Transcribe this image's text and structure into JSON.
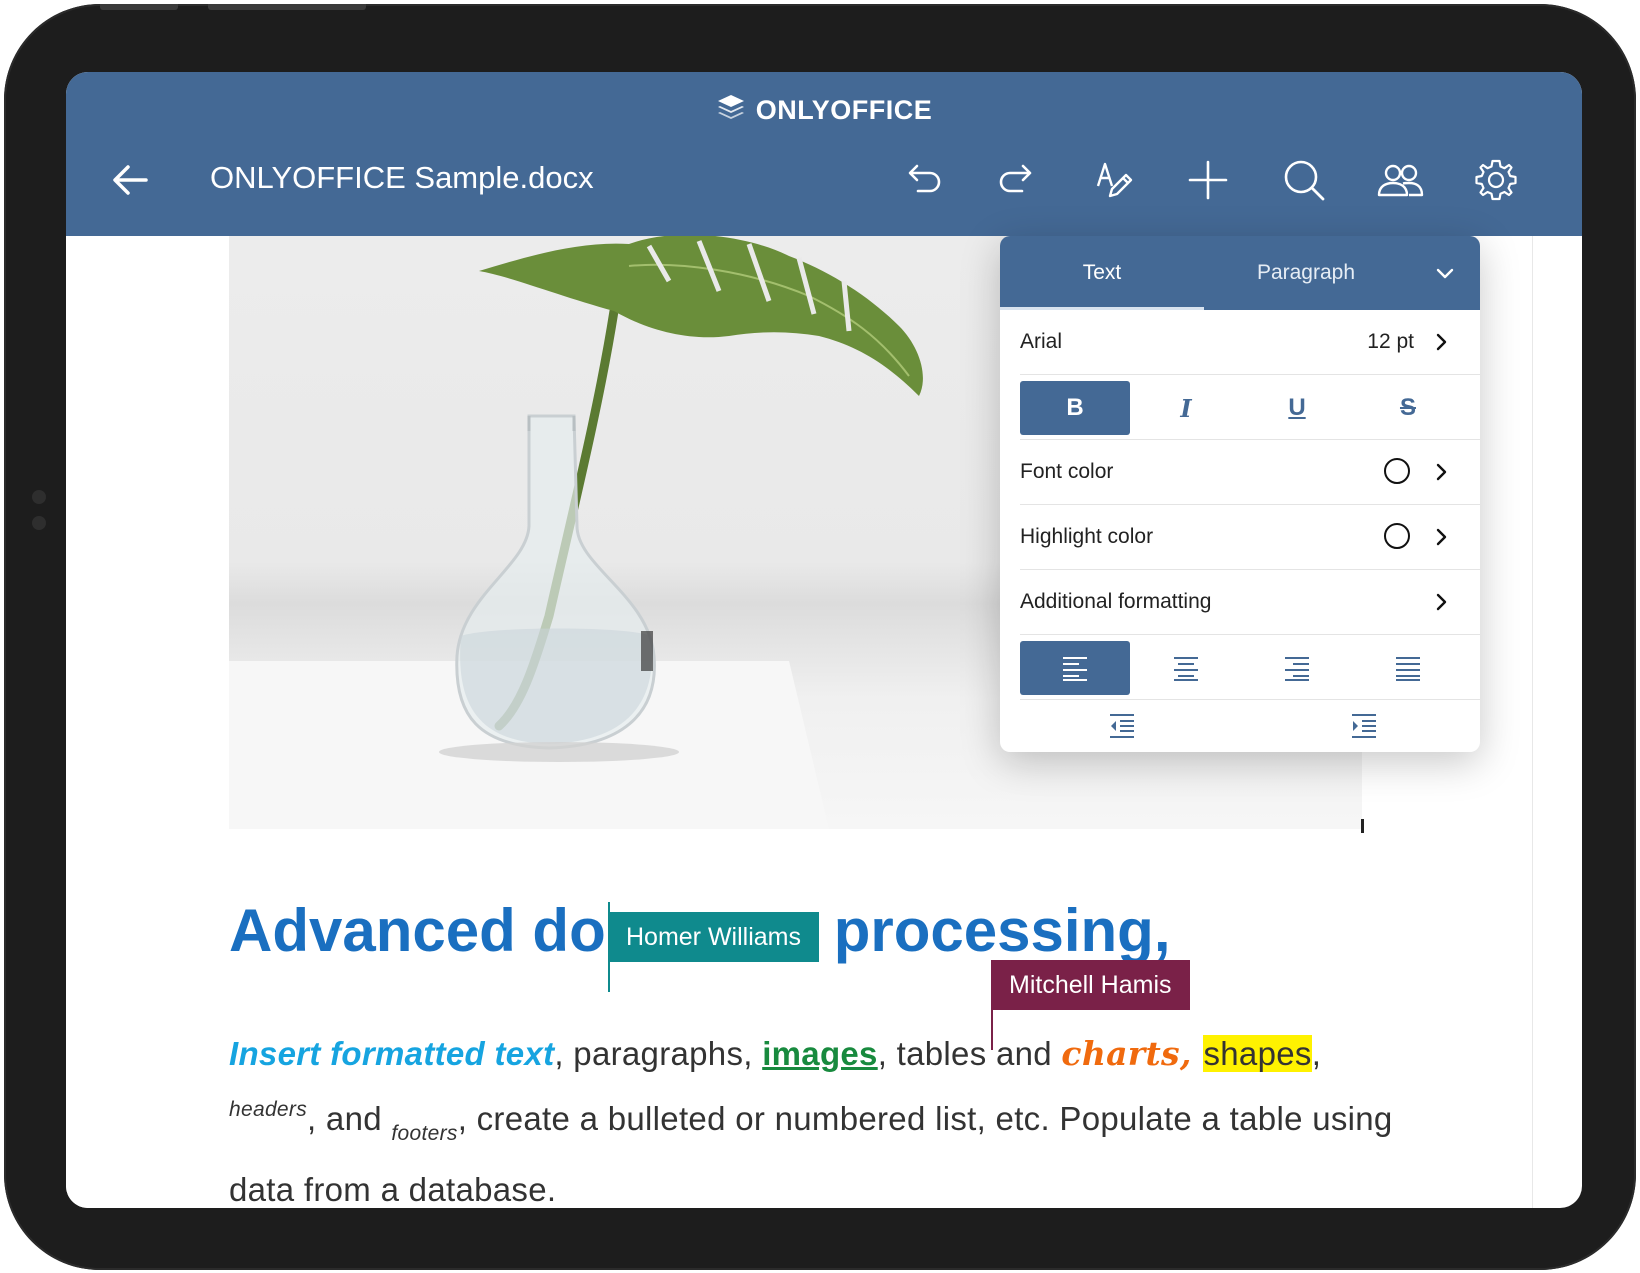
{
  "app": {
    "brand": "ONLYOFFICE",
    "document_title": "ONLYOFFICE Sample.docx"
  },
  "toolbar": {
    "icons": [
      "back-arrow-icon",
      "undo-icon",
      "redo-icon",
      "edit-text-icon",
      "add-icon",
      "search-icon",
      "users-icon",
      "settings-icon"
    ]
  },
  "document": {
    "heading_before": "Advanced do",
    "heading_after": "processing,",
    "para": {
      "p1": "Insert formatted text",
      "p2": ",  paragraphs, ",
      "p3": "images",
      "p4": ", tables and ",
      "p5": "charts",
      "p6": ", ",
      "p7": "shapes",
      "p8": ",",
      "p9": "headers",
      "p10": ", and ",
      "p11": "footers",
      "p12": ", create a bulleted or numbered list, etc. Populate a table using data from a database."
    },
    "collaborators": [
      {
        "name": "Homer Williams",
        "color": "#0f8a8d"
      },
      {
        "name": "Mitchell Hamis",
        "color": "#7a2148"
      }
    ]
  },
  "panel": {
    "tabs": {
      "text": "Text",
      "paragraph": "Paragraph"
    },
    "font_name": "Arial",
    "font_size": "12 pt",
    "style_buttons": {
      "bold": "B",
      "italic": "I",
      "underline": "U",
      "strike": "S"
    },
    "font_color_label": "Font color",
    "highlight_color_label": "Highlight color",
    "additional_formatting_label": "Additional formatting",
    "accent_color": "#446995"
  }
}
